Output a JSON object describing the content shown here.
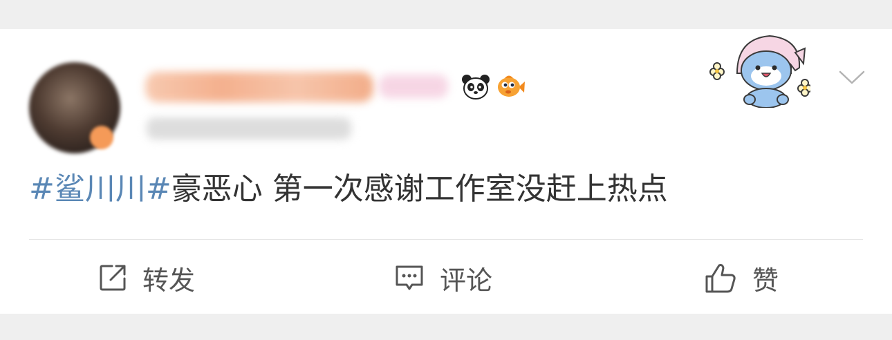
{
  "post": {
    "topic": "#鲨川川#",
    "body": "豪恶心 第一次感谢工作室没赶上热点"
  },
  "actions": {
    "repost": "转发",
    "comment": "评论",
    "like": "赞"
  },
  "icons": {
    "author_badges": [
      "panda-icon",
      "goldfish-icon"
    ],
    "sticker": "baby-shark-sticker",
    "menu": "chevron-down-icon",
    "repost": "repost-icon",
    "comment": "comment-icon",
    "like": "thumbs-up-icon"
  },
  "colors": {
    "topic": "#5a87b5",
    "text": "#333333",
    "action": "#555555",
    "background": "#efefef"
  }
}
